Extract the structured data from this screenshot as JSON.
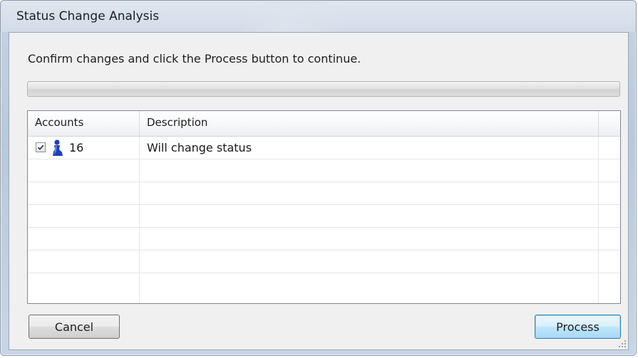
{
  "window": {
    "title": "Status Change Analysis"
  },
  "instruction": "Confirm changes and click the Process button to continue.",
  "progress": {
    "value_percent": 0
  },
  "grid": {
    "columns": [
      "Accounts",
      "Description"
    ],
    "rows": [
      {
        "checked": true,
        "icon": "person-icon",
        "accounts": "16",
        "description": "Will change status"
      },
      {
        "accounts": "",
        "description": ""
      },
      {
        "accounts": "",
        "description": ""
      },
      {
        "accounts": "",
        "description": ""
      },
      {
        "accounts": "",
        "description": ""
      },
      {
        "accounts": "",
        "description": ""
      }
    ]
  },
  "buttons": {
    "cancel": "Cancel",
    "process": "Process"
  },
  "colors": {
    "person_icon": "#1f3fbf",
    "default_button_border": "#3c7fb1"
  }
}
